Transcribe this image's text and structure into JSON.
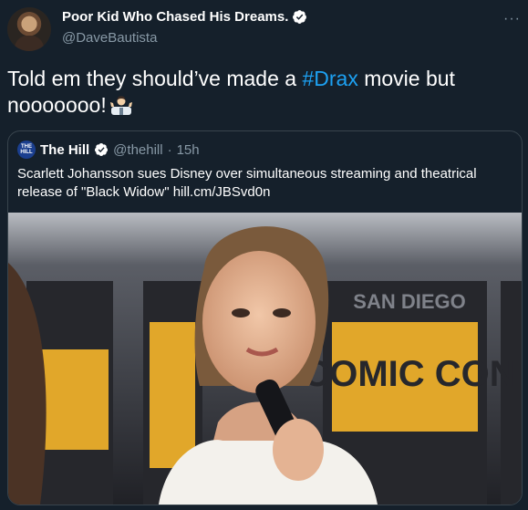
{
  "tweet": {
    "display_name": "Poor Kid Who Chased His Dreams.",
    "handle": "@DaveBautista",
    "more": "···",
    "text_before": "Told em they should’ve made a ",
    "hashtag": "#Drax",
    "text_after": " movie but nooooooo!",
    "emoji": "man-shrugging-icon"
  },
  "quoted_tweet": {
    "logo_text": "THE HILL",
    "name": "The Hill",
    "handle": "@thehill",
    "separator": "·",
    "time": "15h",
    "text": "Scarlett Johansson sues Disney over simultaneous streaming and theatrical release of \"Black Widow\" hill.cm/JBSvd0n",
    "image_banner_top": "SAN DIEGO",
    "image_banner_bottom": "COMIC CON"
  },
  "colors": {
    "background": "#15202b",
    "text": "#ffffff",
    "secondary": "#8899a6",
    "accent": "#1da1f2",
    "border": "#38444d"
  }
}
